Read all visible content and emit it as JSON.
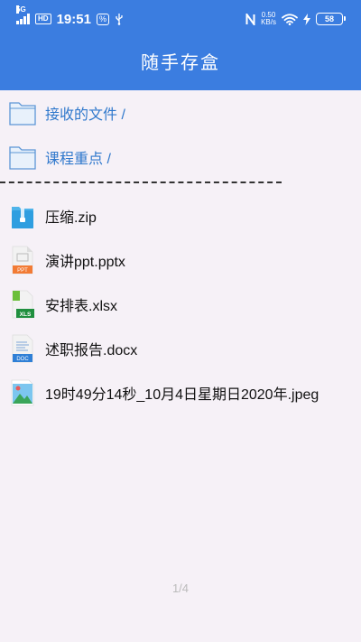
{
  "status_bar": {
    "network": "5G",
    "hd": "HD",
    "time": "19:51",
    "speed_value": "0.50",
    "speed_unit": "KB/s",
    "battery": "58"
  },
  "header": {
    "title": "随手存盒"
  },
  "folders": [
    {
      "label": "接收的文件 /"
    },
    {
      "label": "课程重点 /"
    }
  ],
  "files": [
    {
      "label": "压缩.zip",
      "type": "zip"
    },
    {
      "label": "演讲ppt.pptx",
      "type": "ppt"
    },
    {
      "label": "安排表.xlsx",
      "type": "xls"
    },
    {
      "label": "述职报告.docx",
      "type": "doc"
    },
    {
      "label": "19时49分14秒_10月4日星期日2020年.jpeg",
      "type": "image"
    }
  ],
  "icon_text": {
    "ppt": "PPT",
    "xls": "XLS",
    "doc": "DOC"
  },
  "pager": {
    "text": "1/4"
  },
  "colors": {
    "accent": "#3b7de0",
    "folder_text": "#2f78cc",
    "background": "#f6f1f7"
  }
}
